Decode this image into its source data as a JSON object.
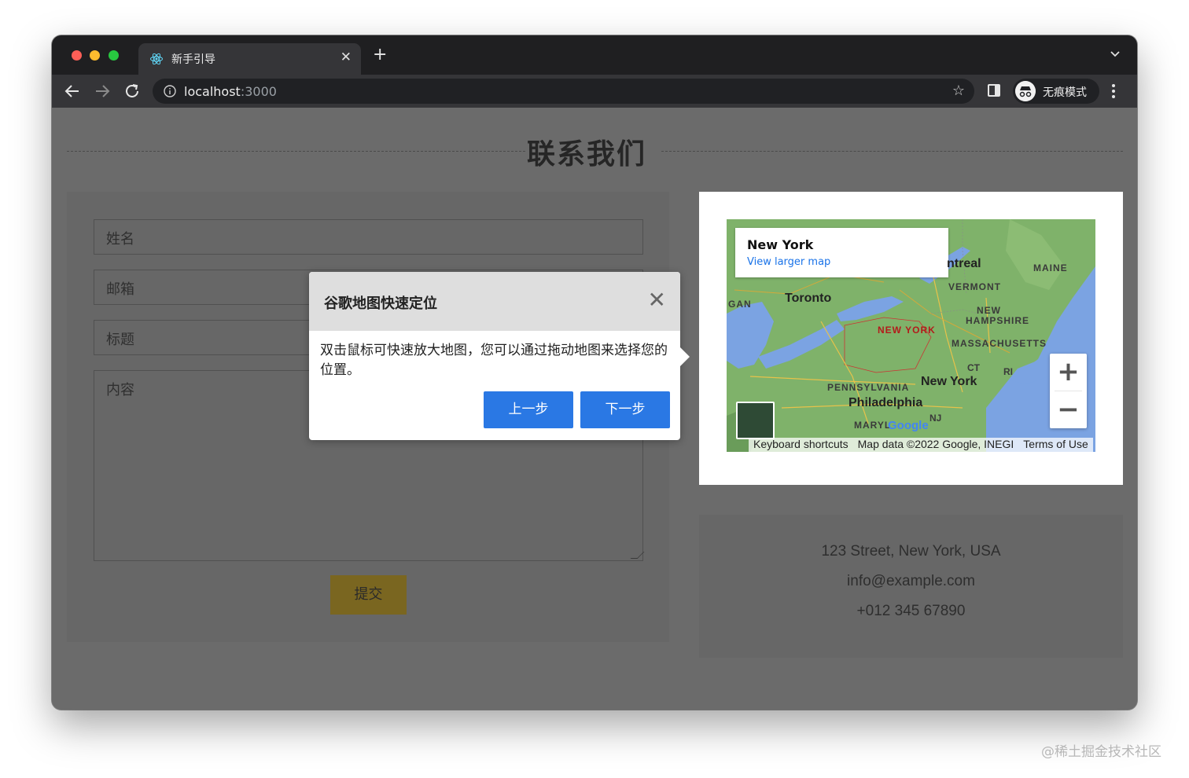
{
  "browser": {
    "tab_title": "新手引导",
    "tab_close": "✕",
    "new_tab": "+",
    "url_host": "localhost",
    "url_port": ":3000",
    "bookmark_star": "☆",
    "incognito_label": "无痕模式"
  },
  "page": {
    "title": "联系我们",
    "form": {
      "name_placeholder": "姓名",
      "email_placeholder": "邮箱",
      "subject_placeholder": "标题",
      "content_placeholder": "内容",
      "submit_label": "提交"
    },
    "map": {
      "place_name": "New York",
      "larger_map_link": "View larger map",
      "zoom_in": "+",
      "zoom_out": "−",
      "footer": {
        "shortcuts": "Keyboard shortcuts",
        "map_data": "Map data ©2022 Google, INEGI",
        "terms": "Terms of Use"
      },
      "labels": {
        "toronto": "Toronto",
        "montreal": "ntreal",
        "maine": "MAINE",
        "vermont": "VERMONT",
        "new_hampshire_1": "NEW",
        "new_hampshire_2": "HAMPSHIRE",
        "new_york_state": "NEW YORK",
        "massachusetts": "MASSACHUSETTS",
        "michigan": "GAN",
        "ct": "CT",
        "ri": "RI",
        "new_york_city": "New York",
        "pennsylvania": "PENNSYLVANIA",
        "philadelphia": "Philadelphia",
        "nj": "NJ",
        "maryland": "MARYL",
        "google": "Google"
      }
    },
    "contact": {
      "address": "123 Street, New York, USA",
      "email": "info@example.com",
      "phone": "+012 345 67890"
    }
  },
  "guide": {
    "title": "谷歌地图快速定位",
    "close": "✕",
    "body": "双击鼠标可快速放大地图，您可以通过拖动地图来选择您的位置。",
    "prev_label": "上一步",
    "next_label": "下一步"
  },
  "watermark": "@稀土掘金技术社区",
  "colors": {
    "overlay_gray": "#6b6b6b",
    "primary_button": "#2a78e4",
    "submit_dimmed": "#7a6620",
    "map_water": "#7ba3e2",
    "map_land": "#7fb26a"
  }
}
